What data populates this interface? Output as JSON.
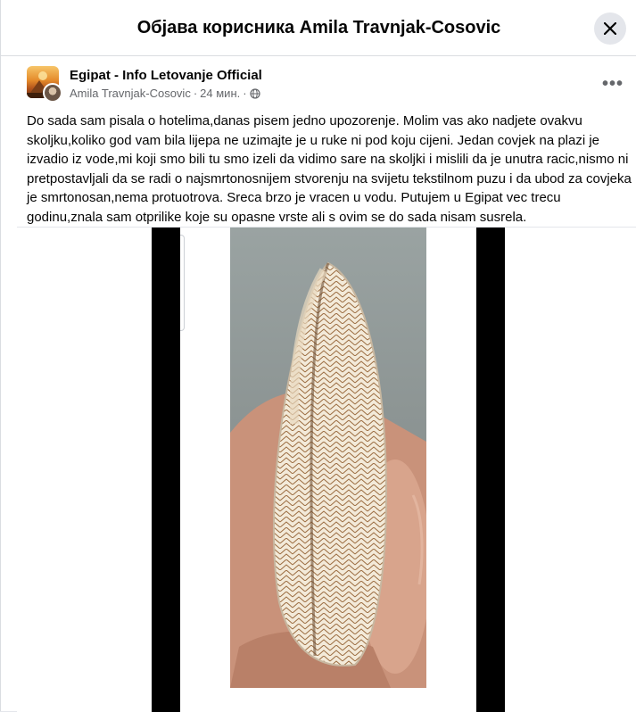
{
  "dialog": {
    "title": "Објава корисника Amila Travnjak-Cosovic",
    "close_icon": "close-icon"
  },
  "post": {
    "page_name": "Egipat - Info Letovanje Official",
    "author": "Amila Travnjak-Cosovic",
    "separator": "·",
    "time": "24 мин.",
    "audience_icon": "globe-icon",
    "more_icon": "more-horizontal-icon",
    "more_label": "•••",
    "text": "Do sada sam pisala o hotelima,danas pisem jedno upozorenje. Molim vas ako nadjete ovakvu skoljku,koliko god vam bila lijepa ne uzimajte je u ruke ni pod koju cijeni. Jedan covjek na plazi je izvadio iz vode,mi koji smo bili tu smo izeli da vidimo sare na skoljki i mislili da je unutra racic,nismo ni pretpostavljali da se radi o najsmrtonosnijem stvorenju na svijetu tekstilnom puzu i da ubod za covjeka je smrtonosan,nema protuotrova. Sreca brzo je vracen u vodu. Putujem u Egipat vec trecu godinu,znala sam otprilike koje su opasne vrste ali s ovim se do sada nisam susrela."
  },
  "colors": {
    "primary_text": "#050505",
    "secondary_text": "#65676b",
    "divider": "#dadde1",
    "button_bg": "#e4e6eb"
  }
}
